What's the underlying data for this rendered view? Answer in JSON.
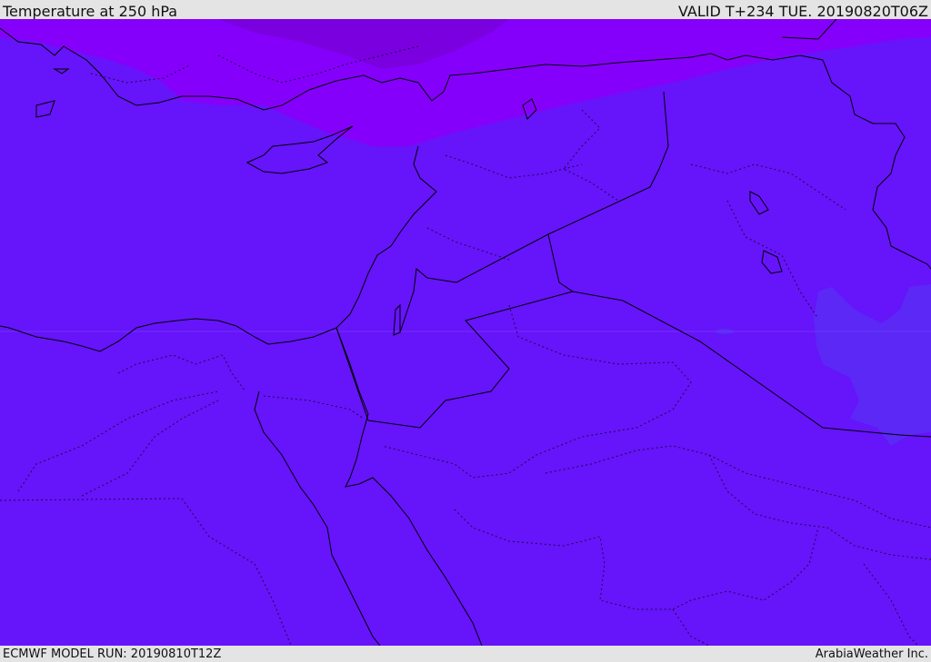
{
  "header": {
    "title": "Temperature at 250 hPa",
    "valid": "VALID T+234 TUE. 20190820T06Z"
  },
  "footer": {
    "model_run": "ECMWF MODEL RUN: 20190810T12Z",
    "credit": "ArabiaWeather Inc."
  },
  "map": {
    "colors": {
      "base_fill": "#6614fa",
      "cold_band": "#8500fa",
      "coldest_core": "#7a00e0",
      "warm_patch": "#5a2af5",
      "coastline": "#000000",
      "borders": "#000000"
    }
  }
}
